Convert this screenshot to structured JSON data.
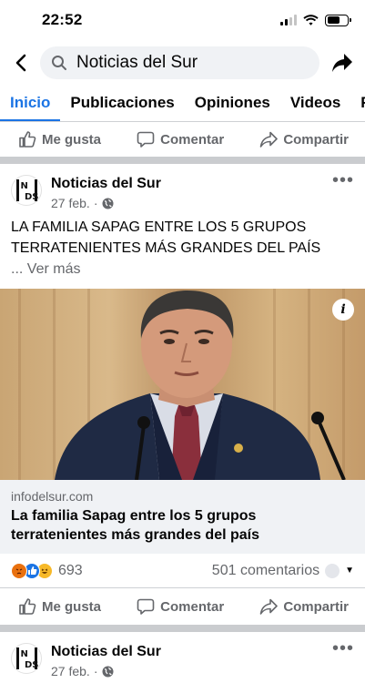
{
  "status": {
    "time": "22:52"
  },
  "search": {
    "query": "Noticias del Sur"
  },
  "tabs": [
    {
      "label": "Inicio"
    },
    {
      "label": "Publicaciones"
    },
    {
      "label": "Opiniones"
    },
    {
      "label": "Videos"
    },
    {
      "label": "Fo"
    }
  ],
  "actions": {
    "like": "Me gusta",
    "comment": "Comentar",
    "share": "Compartir"
  },
  "post1": {
    "page_name": "Noticias del Sur",
    "date": "27 feb.",
    "separator": "·",
    "text": "LA FAMILIA SAPAG ENTRE LOS 5 GRUPOS TERRATENIENTES MÁS GRANDES DEL PAÍS",
    "see_more": "... Ver más",
    "link_domain": "infodelsur.com",
    "link_title": "La familia Sapag entre los 5 grupos terratenientes más grandes del país",
    "reaction_count": "693",
    "comments": "501 comentarios"
  },
  "post2": {
    "page_name": "Noticias del Sur",
    "date": "27 feb.",
    "separator": "·"
  },
  "colors": {
    "accent": "#1b74e4",
    "secondary_text": "#65676b",
    "divider": "#cacccf"
  },
  "icons": [
    "back-icon",
    "search-icon",
    "share-icon",
    "like-icon",
    "comment-icon",
    "globe-icon",
    "more-icon",
    "info-icon"
  ]
}
